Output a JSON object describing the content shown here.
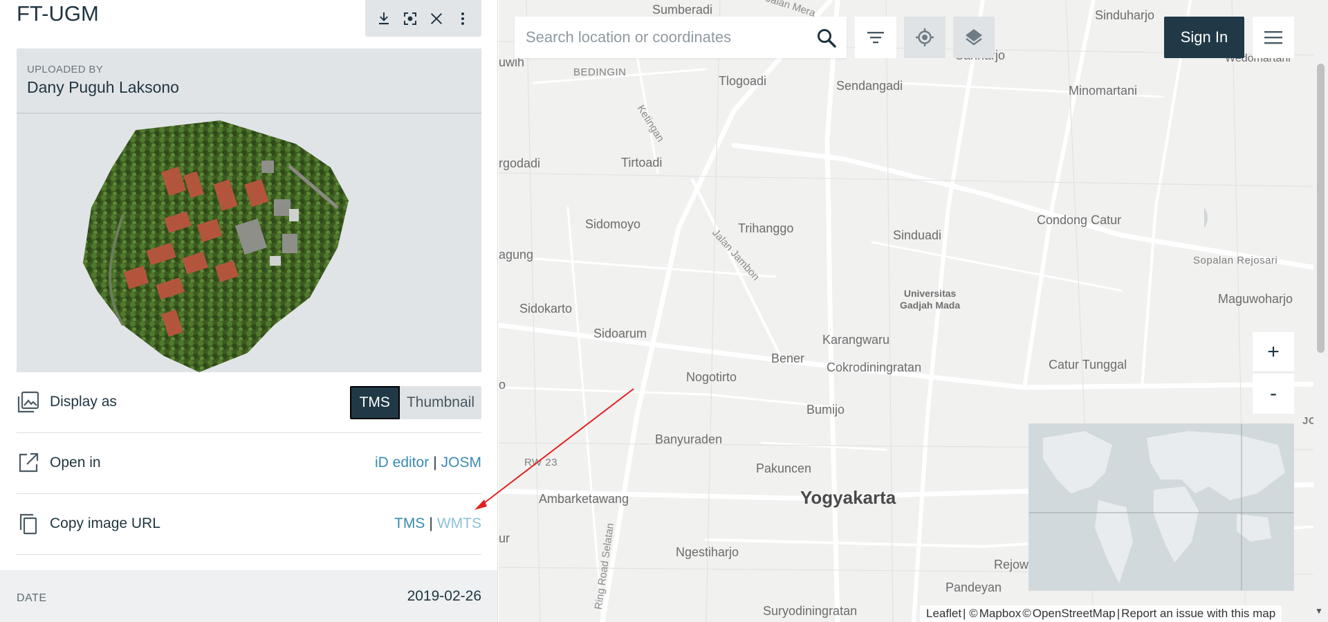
{
  "panel": {
    "title": "FT-UGM",
    "toolbar": [
      "download-icon",
      "focus-icon",
      "close-icon",
      "more-vertical-icon"
    ],
    "uploader_label": "UPLOADED BY",
    "uploader_name": "Dany Puguh Laksono",
    "display_as": {
      "label": "Display as",
      "options": [
        "TMS",
        "Thumbnail"
      ],
      "selected": "TMS"
    },
    "open_in": {
      "label": "Open in",
      "links": [
        "iD editor",
        "JOSM"
      ],
      "separator": "|"
    },
    "copy_url": {
      "label": "Copy image URL",
      "links": [
        "TMS",
        "WMTS"
      ],
      "separator": "|"
    },
    "date": {
      "label": "DATE",
      "value": "2019-02-26"
    }
  },
  "map": {
    "search": {
      "placeholder": "Search location or coordinates"
    },
    "controls": [
      "filter-icon",
      "locate-icon",
      "layers-icon"
    ],
    "sign_in": "Sign In",
    "zoom_in": "+",
    "zoom_out": "-",
    "attribution": {
      "leaflet": "Leaflet",
      "sep": " | © ",
      "mapbox": "Mapbox",
      "osm_prefix": " © ",
      "osm": "OpenStreetMap",
      "report": "Report an issue with this map"
    },
    "places": {
      "sumberadi": "Sumberadi",
      "jalan_merapi": "Jalan Mera",
      "sinduharjo": "Sinduharjo",
      "wedomartani": "Wedomartani",
      "luwih": "uwih",
      "bedingin": "BEDINGIN",
      "tlogoadi": "Tlogoadi",
      "sendangadi": "Sendangadi",
      "sariharjo": "Sariharjo",
      "minomartani": "Minomartani",
      "ketingan": "Ketingan",
      "rgodadi": "rgodadi",
      "tirtoadi": "Tirtoadi",
      "sidomoyo": "Sidomoyo",
      "trihanggo": "Trihanggo",
      "sinduadi": "Sinduadi",
      "condong_catur": "Condong Catur",
      "jalan_jambon": "Jalan Jambon",
      "agung": "agung",
      "sopalan": "Sopalan Rejosari",
      "universitas": "Universitas",
      "gadjah_mada": "Gadjah Mada",
      "maguwoharjo": "Maguwoharjo",
      "sidokarto": "Sidokarto",
      "sidoarum": "Sidoarum",
      "karangwaru": "Karangwaru",
      "bener": "Bener",
      "cokrodiningratan": "Cokrodiningratan",
      "catur_tunggal": "Catur Tunggal",
      "nogotirto": "Nogotirto",
      "bumijo": "Bumijo",
      "banyuraden": "Banyuraden",
      "jog": "JOG",
      "rw23": "RW 23",
      "pakuncen": "Pakuncen",
      "ambarketawang": "Ambarketawang",
      "yogyakarta": "Yogyakarta",
      "ur": "ur",
      "ring_road": "Ring Road Selatan",
      "ngestiharjo": "Ngestiharjo",
      "rejowi": "Rejowi",
      "pandeyan": "Pandeyan",
      "suryodiningratan": "Suryodiningratan",
      "o": "o"
    }
  }
}
